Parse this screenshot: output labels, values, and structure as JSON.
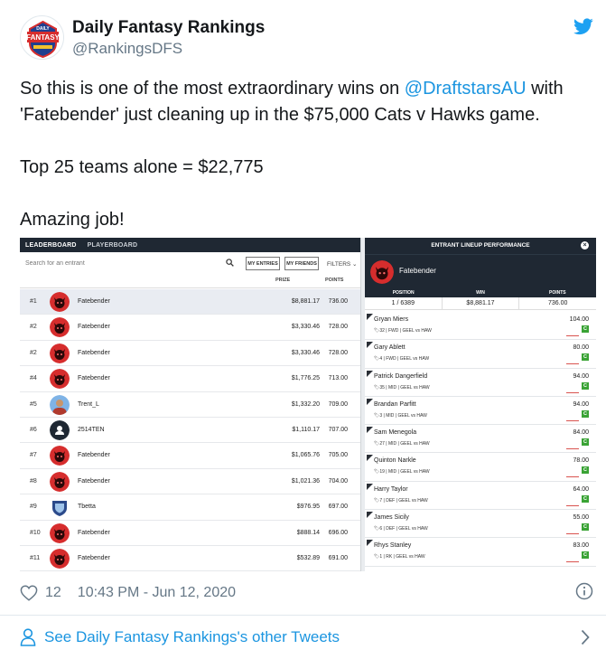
{
  "author": {
    "display_name": "Daily Fantasy Rankings",
    "handle": "@RankingsDFS",
    "avatar_text_top": "DAILY",
    "avatar_text_main": "FANTASY"
  },
  "tweet": {
    "line1_pre": "So this is one of the most extraordinary wins on ",
    "mention": "@DraftstarsAU",
    "line1_post": " with",
    "line2": "'Fatebender' just cleaning up in the $75,000 Cats v Hawks game.",
    "line3": "Top 25 teams alone = $22,775",
    "line4": "Amazing job!"
  },
  "leaderboard": {
    "tabs": [
      "LEADERBOARD",
      "PLAYERBOARD"
    ],
    "search_placeholder": "Search for an entrant",
    "btn_my_entries": "MY ENTRIES",
    "btn_my_friends": "MY FRIENDS",
    "filters": "FILTERS ⌄",
    "col_prize": "PRIZE",
    "col_points": "POINTS",
    "rows": [
      {
        "rank": "#1",
        "name": "Fatebender",
        "prize": "$8,881.17",
        "points": "736.00",
        "avatar": "devil"
      },
      {
        "rank": "#2",
        "name": "Fatebender",
        "prize": "$3,330.46",
        "points": "728.00",
        "avatar": "devil"
      },
      {
        "rank": "#2",
        "name": "Fatebender",
        "prize": "$3,330.46",
        "points": "728.00",
        "avatar": "devil"
      },
      {
        "rank": "#4",
        "name": "Fatebender",
        "prize": "$1,776.25",
        "points": "713.00",
        "avatar": "devil"
      },
      {
        "rank": "#5",
        "name": "Trent_L",
        "prize": "$1,332.20",
        "points": "709.00",
        "avatar": "photo"
      },
      {
        "rank": "#6",
        "name": "2514TEN",
        "prize": "$1,110.17",
        "points": "707.00",
        "avatar": "default"
      },
      {
        "rank": "#7",
        "name": "Fatebender",
        "prize": "$1,065.76",
        "points": "705.00",
        "avatar": "devil"
      },
      {
        "rank": "#8",
        "name": "Fatebender",
        "prize": "$1,021.36",
        "points": "704.00",
        "avatar": "devil"
      },
      {
        "rank": "#9",
        "name": "Tbetta",
        "prize": "$976.95",
        "points": "697.00",
        "avatar": "crest"
      },
      {
        "rank": "#10",
        "name": "Fatebender",
        "prize": "$888.14",
        "points": "696.00",
        "avatar": "devil"
      },
      {
        "rank": "#11",
        "name": "Fatebender",
        "prize": "$532.89",
        "points": "691.00",
        "avatar": "devil"
      }
    ]
  },
  "lineup": {
    "title": "ENTRANT LINEUP PERFORMANCE",
    "close": "×",
    "user": "Fatebender",
    "stat_heads": [
      "POSITION",
      "WIN",
      "POINTS"
    ],
    "stats": [
      "1 / 6389",
      "$8,881.17",
      "736.00"
    ],
    "badge": "C",
    "players": [
      {
        "name": "Gryan Miers",
        "meta": "🏷32 | FWD | GEEL vs HAW",
        "points": "104.00"
      },
      {
        "name": "Gary Ablett",
        "meta": "🏷4 | FWD | GEEL vs HAW",
        "points": "80.00"
      },
      {
        "name": "Patrick Dangerfield",
        "meta": "🏷35 | MID | GEEL vs HAW",
        "points": "94.00"
      },
      {
        "name": "Brandan Parfitt",
        "meta": "🏷3 | MID | GEEL vs HAW",
        "points": "94.00"
      },
      {
        "name": "Sam Menegola",
        "meta": "🏷27 | MID | GEEL vs HAW",
        "points": "84.00"
      },
      {
        "name": "Quinton Narkle",
        "meta": "🏷19 | MID | GEEL vs HAW",
        "points": "78.00"
      },
      {
        "name": "Harry Taylor",
        "meta": "🏷7 | DEF | GEEL vs HAW",
        "points": "64.00"
      },
      {
        "name": "James Sicily",
        "meta": "🏷6 | DEF | GEEL vs HAW",
        "points": "55.00"
      },
      {
        "name": "Rhys Stanley",
        "meta": "🏷1 | RK | GEEL vs HAW",
        "points": "83.00"
      }
    ]
  },
  "footer": {
    "likes": "12",
    "timestamp": "10:43 PM - Jun 12, 2020",
    "see_more": "See Daily Fantasy Rankings's other Tweets"
  },
  "colors": {
    "link": "#1b95e0",
    "dark_panel": "#1f2833",
    "devil_red": "#d62d2d"
  }
}
